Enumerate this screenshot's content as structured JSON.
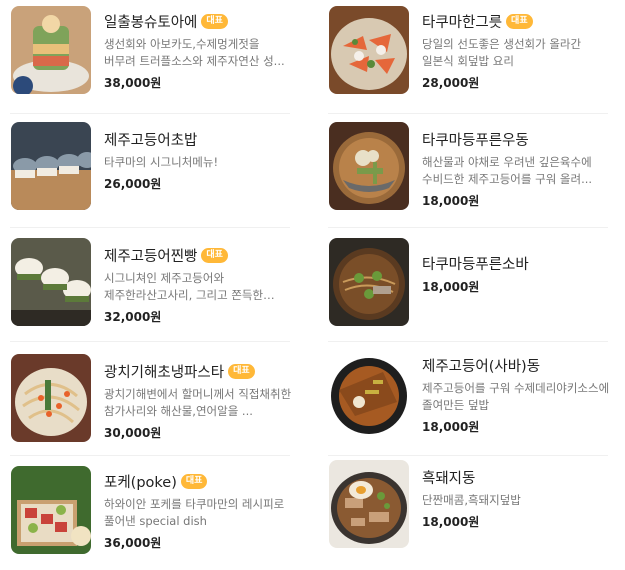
{
  "menu": {
    "left": [
      {
        "name": "일출봉슈토아에",
        "badge": "대표",
        "desc": "생선회와 아보카도,수제멍게젓을 버무려 트러플소스와 제주자연산 성...",
        "price": "38,000원",
        "image": "poke-tower-dish"
      },
      {
        "name": "제주고등어초밥",
        "badge": "",
        "desc": "타쿠마의 시그니처메뉴!",
        "price": "26,000원",
        "image": "mackerel-sushi"
      },
      {
        "name": "제주고등어찐빵",
        "badge": "대표",
        "desc": "시그니쳐인 제주고등어와 제주한라산고사리, 그리고 쫀득한 하마보찐...",
        "price": "32,000원",
        "image": "mackerel-buns"
      },
      {
        "name": "광치기해초냉파스타",
        "badge": "대표",
        "desc": "광치기해변에서 할머니께서 직접채취한 참가사리와 해산물,연어알을 ...",
        "price": "30,000원",
        "image": "seaweed-pasta"
      },
      {
        "name": "포케(poke)",
        "badge": "대표",
        "desc": "하와이안 포케를 타쿠마만의 레시피로 풀어낸 special dish",
        "price": "36,000원",
        "image": "poke-bowl"
      }
    ],
    "right": [
      {
        "name": "타쿠마한그릇",
        "badge": "대표",
        "desc": "당일의 선도좋은 생선회가 올라간 일본식 회덮밥 요리",
        "price": "28,000원",
        "image": "sashimi-rice-bowl"
      },
      {
        "name": "타쿠마등푸른우동",
        "badge": "",
        "desc": "해산물과 야채로 우려낸 깊은육수에 수비드한 제주고등어를 구워 올려...",
        "price": "18,000원",
        "image": "mackerel-udon"
      },
      {
        "name": "타쿠마등푸른소바",
        "badge": "",
        "desc": "",
        "price": "18,000원",
        "image": "mackerel-soba"
      },
      {
        "name": "제주고등어(사바)동",
        "badge": "",
        "desc": "제주고등어를 구워 수제데리야키소스에 졸여만든 덮밥",
        "price": "18,000원",
        "image": "saba-don"
      },
      {
        "name": "흑돼지동",
        "badge": "",
        "desc": "단짠매콤,흑돼지덮밥",
        "price": "18,000원",
        "image": "black-pork-don"
      }
    ]
  },
  "colors": {
    "badge": "#ffb838",
    "price": "#222222",
    "desc": "#777777"
  }
}
